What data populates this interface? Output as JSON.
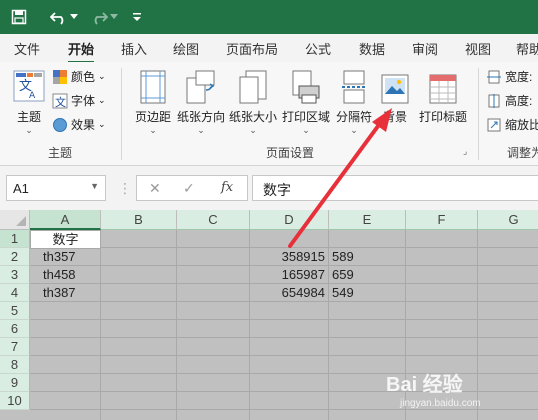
{
  "quick_access": {
    "save_icon": "save-icon",
    "undo_icon": "undo-icon",
    "redo_icon": "redo-icon",
    "customize_icon": "customize-toolbar-icon"
  },
  "tabs": [
    {
      "label": "文件"
    },
    {
      "label": "开始"
    },
    {
      "label": "插入"
    },
    {
      "label": "绘图"
    },
    {
      "label": "页面布局",
      "active": true
    },
    {
      "label": "公式"
    },
    {
      "label": "数据"
    },
    {
      "label": "审阅"
    },
    {
      "label": "视图"
    },
    {
      "label": "帮助"
    }
  ],
  "ribbon": {
    "theme_group": {
      "label": "主题",
      "themes_btn": "主题",
      "colors_btn": "颜色",
      "fonts_btn": "字体",
      "effects_btn": "效果"
    },
    "page_setup_group": {
      "label": "页面设置",
      "margins_btn": "页边距",
      "orientation_btn": "纸张方向",
      "size_btn": "纸张大小",
      "print_area_btn": "打印区域",
      "breaks_btn": "分隔符",
      "background_btn": "背景",
      "print_titles_btn": "打印标题"
    },
    "scale_group": {
      "label": "调整为",
      "width_btn": "宽度:",
      "height_btn": "高度:",
      "scale_btn": "缩放比"
    }
  },
  "formula_bar": {
    "name_box": "A1",
    "cancel_icon": "✕",
    "enter_icon": "✓",
    "fx_label": "fx",
    "content": "数字"
  },
  "sheet": {
    "columns": [
      "A",
      "B",
      "C",
      "D",
      "E",
      "F",
      "G"
    ],
    "rows": [
      "1",
      "2",
      "3",
      "4",
      "5",
      "6",
      "7",
      "8",
      "9",
      "10"
    ],
    "cells": {
      "A1": "数字",
      "A2": "th357",
      "A3": "th458",
      "A4": "th387",
      "D2": "358915",
      "D3": "165987",
      "D4": "654984",
      "E2": "589",
      "E3": "659",
      "E4": "549"
    }
  },
  "watermark": {
    "main": "Bai 经验",
    "sub": "jingyan.baidu.com"
  },
  "colors": {
    "accent": "#217346",
    "header_green": "#d9ede2",
    "sheet_bg": "#c0c0c0",
    "arrow": "#e8303a"
  }
}
